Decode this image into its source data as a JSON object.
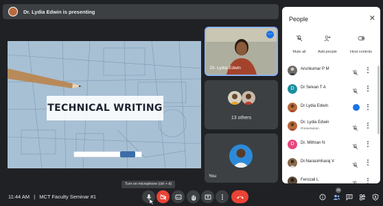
{
  "presenting": {
    "text": "Dr. Lydia Edwin is presenting"
  },
  "slide": {
    "title": "TECHNICAL WRITING"
  },
  "tiles": {
    "main_speaker": {
      "label": "Dr. Lydia Edwin"
    },
    "others": {
      "label": "13 others"
    },
    "self": {
      "label": "You"
    }
  },
  "people_panel": {
    "title": "People",
    "actions": [
      {
        "label": "Mute all",
        "icon": "mic-off-icon"
      },
      {
        "label": "Add people",
        "icon": "person-add-icon"
      },
      {
        "label": "Host controls",
        "icon": "toggle-icon"
      }
    ],
    "participants": [
      {
        "name": "Arunkumar P M",
        "subtitle": "",
        "avatar_letter": "",
        "avatar_color": "#6b6b6b",
        "status": "muted"
      },
      {
        "name": "Dr Selvan T A",
        "subtitle": "",
        "avatar_letter": "D",
        "avatar_color": "#1e8e9e",
        "status": "muted"
      },
      {
        "name": "Dr Lydia Edwin",
        "subtitle": "",
        "avatar_letter": "",
        "avatar_color": "#b86a3c",
        "status": "speaking"
      },
      {
        "name": "Dr. Lydia Edwin",
        "subtitle": "Presentation",
        "avatar_letter": "",
        "avatar_color": "#b86a3c",
        "status": "muted"
      },
      {
        "name": "Dr. Mithran N",
        "subtitle": "",
        "avatar_letter": "D",
        "avatar_color": "#e8467c",
        "status": "muted"
      },
      {
        "name": "Dr.Narasimharaj V",
        "subtitle": "",
        "avatar_letter": "",
        "avatar_color": "#8a6a4a",
        "status": "muted"
      },
      {
        "name": "Ferozali L",
        "subtitle": "",
        "avatar_letter": "",
        "avatar_color": "#5a4a3a",
        "status": "muted"
      }
    ]
  },
  "bottom_bar": {
    "time": "11:44 AM",
    "separator": "|",
    "meeting_name": "MCT Faculty Seminar #1",
    "tooltip": "Turn on microphone (ctrl + d)",
    "participant_count": "16"
  },
  "colors": {
    "accent": "#1a73e8",
    "danger": "#ea4335",
    "bar": "#202124"
  }
}
